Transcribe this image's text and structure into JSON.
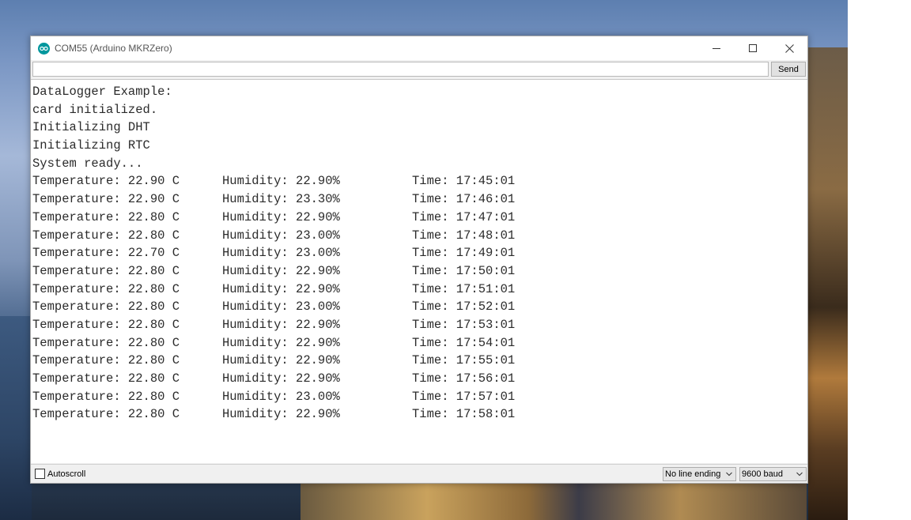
{
  "window": {
    "title": "COM55 (Arduino MKRZero)",
    "icon": "arduino-infinity-icon",
    "controls": [
      "minimize-icon",
      "maximize-icon",
      "close-icon"
    ],
    "accent": "#00979d"
  },
  "send_bar": {
    "input_value": "",
    "send_label": "Send"
  },
  "output": {
    "header_lines": [
      "DataLogger Example:",
      "card initialized.",
      "Initializing DHT",
      "Initializing RTC",
      "System ready..."
    ],
    "readings": [
      {
        "temperature": "Temperature: 22.90 C",
        "humidity": "Humidity: 22.90%",
        "time": "Time: 17:45:01"
      },
      {
        "temperature": "Temperature: 22.90 C",
        "humidity": "Humidity: 23.30%",
        "time": "Time: 17:46:01"
      },
      {
        "temperature": "Temperature: 22.80 C",
        "humidity": "Humidity: 22.90%",
        "time": "Time: 17:47:01"
      },
      {
        "temperature": "Temperature: 22.80 C",
        "humidity": "Humidity: 23.00%",
        "time": "Time: 17:48:01"
      },
      {
        "temperature": "Temperature: 22.70 C",
        "humidity": "Humidity: 23.00%",
        "time": "Time: 17:49:01"
      },
      {
        "temperature": "Temperature: 22.80 C",
        "humidity": "Humidity: 22.90%",
        "time": "Time: 17:50:01"
      },
      {
        "temperature": "Temperature: 22.80 C",
        "humidity": "Humidity: 22.90%",
        "time": "Time: 17:51:01"
      },
      {
        "temperature": "Temperature: 22.80 C",
        "humidity": "Humidity: 23.00%",
        "time": "Time: 17:52:01"
      },
      {
        "temperature": "Temperature: 22.80 C",
        "humidity": "Humidity: 22.90%",
        "time": "Time: 17:53:01"
      },
      {
        "temperature": "Temperature: 22.80 C",
        "humidity": "Humidity: 22.90%",
        "time": "Time: 17:54:01"
      },
      {
        "temperature": "Temperature: 22.80 C",
        "humidity": "Humidity: 22.90%",
        "time": "Time: 17:55:01"
      },
      {
        "temperature": "Temperature: 22.80 C",
        "humidity": "Humidity: 22.90%",
        "time": "Time: 17:56:01"
      },
      {
        "temperature": "Temperature: 22.80 C",
        "humidity": "Humidity: 23.00%",
        "time": "Time: 17:57:01"
      },
      {
        "temperature": "Temperature: 22.80 C",
        "humidity": "Humidity: 22.90%",
        "time": "Time: 17:58:01"
      }
    ]
  },
  "bottom_bar": {
    "autoscroll_label": "Autoscroll",
    "autoscroll_checked": false,
    "line_ending": "No line ending",
    "baud_rate": "9600 baud"
  }
}
